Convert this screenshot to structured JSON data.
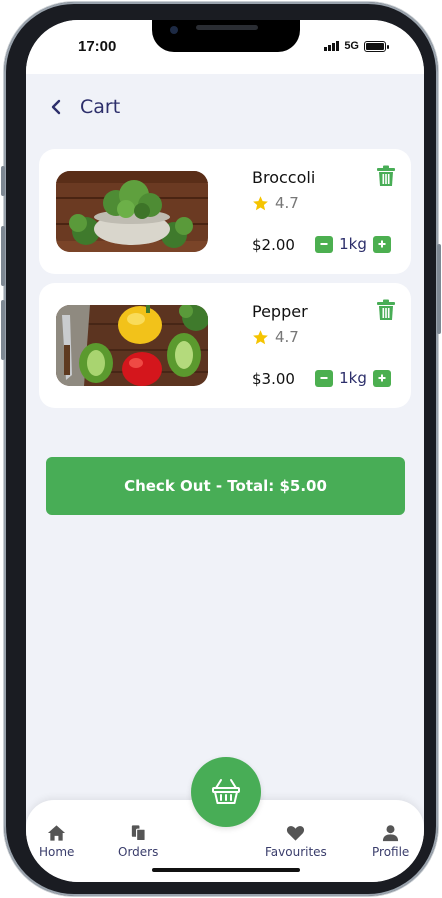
{
  "status_bar": {
    "time": "17:00",
    "network": "5G"
  },
  "header": {
    "title": "Cart"
  },
  "cart_items": [
    {
      "name": "Broccoli",
      "rating": "4.7",
      "price": "$2.00",
      "quantity": "1kg"
    },
    {
      "name": "Pepper",
      "rating": "4.7",
      "price": "$3.00",
      "quantity": "1kg"
    }
  ],
  "checkout": {
    "label": "Check Out - Total: $5.00"
  },
  "bottom_nav": {
    "items": [
      {
        "label": "Home",
        "icon": "home-icon"
      },
      {
        "label": "Orders",
        "icon": "orders-icon"
      },
      {
        "label": "Favourites",
        "icon": "heart-icon"
      },
      {
        "label": "Profile",
        "icon": "user-icon"
      }
    ],
    "center_icon": "basket-icon"
  },
  "colors": {
    "accent": "#48ad56",
    "title": "#2d2f6b",
    "star": "#f5c400",
    "background": "#f0f2f8"
  }
}
